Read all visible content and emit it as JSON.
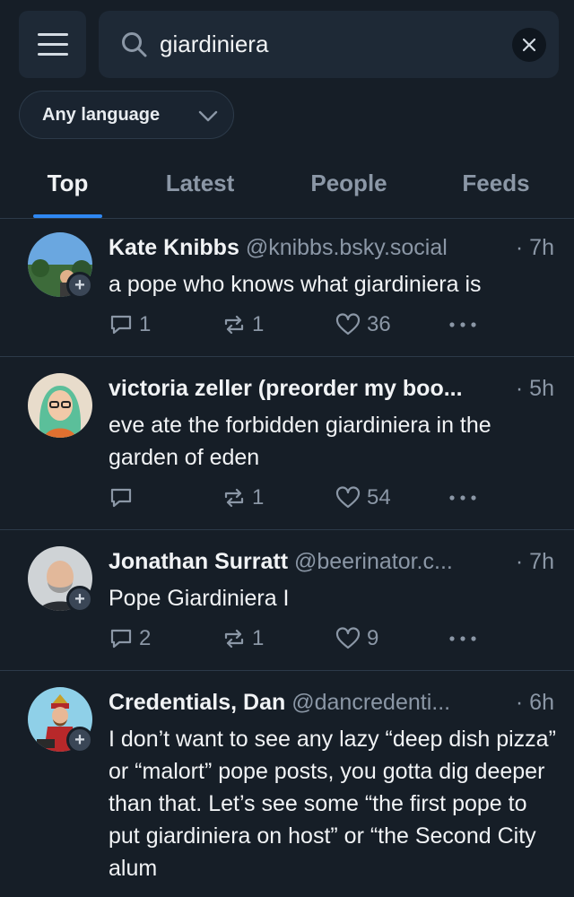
{
  "search": {
    "query": "giardiniera"
  },
  "language_filter": {
    "selected": "Any language"
  },
  "tabs": [
    "Top",
    "Latest",
    "People",
    "Feeds"
  ],
  "active_tab": "Top",
  "colors": {
    "background": "#161e27",
    "accent": "#2f88f3",
    "muted": "#8b97a6"
  },
  "posts": [
    {
      "name": "Kate Knibbs",
      "handle": "@knibbs.bsky.social",
      "time": "· 7h",
      "text": "a pope who knows what giardiniera is",
      "replies": "1",
      "reposts": "1",
      "likes": "36"
    },
    {
      "name": "victoria zeller (preorder my boo...",
      "handle": "",
      "time": "· 5h",
      "text": "eve ate the forbidden giardiniera in the garden of eden",
      "replies": "",
      "reposts": "1",
      "likes": "54"
    },
    {
      "name": "Jonathan Surratt",
      "handle": "@beerinator.c...",
      "time": "· 7h",
      "text": "Pope Giardiniera I",
      "replies": "2",
      "reposts": "1",
      "likes": "9"
    },
    {
      "name": "Credentials, Dan",
      "handle": "@dancredenti...",
      "time": "· 6h",
      "text": "I don’t want to see any lazy “deep dish pizza” or “malort” pope posts, you gotta dig deeper than that. Let’s see some “the first pope to put giardiniera on host” or “the Second City alum",
      "replies": "",
      "reposts": "",
      "likes": ""
    }
  ]
}
